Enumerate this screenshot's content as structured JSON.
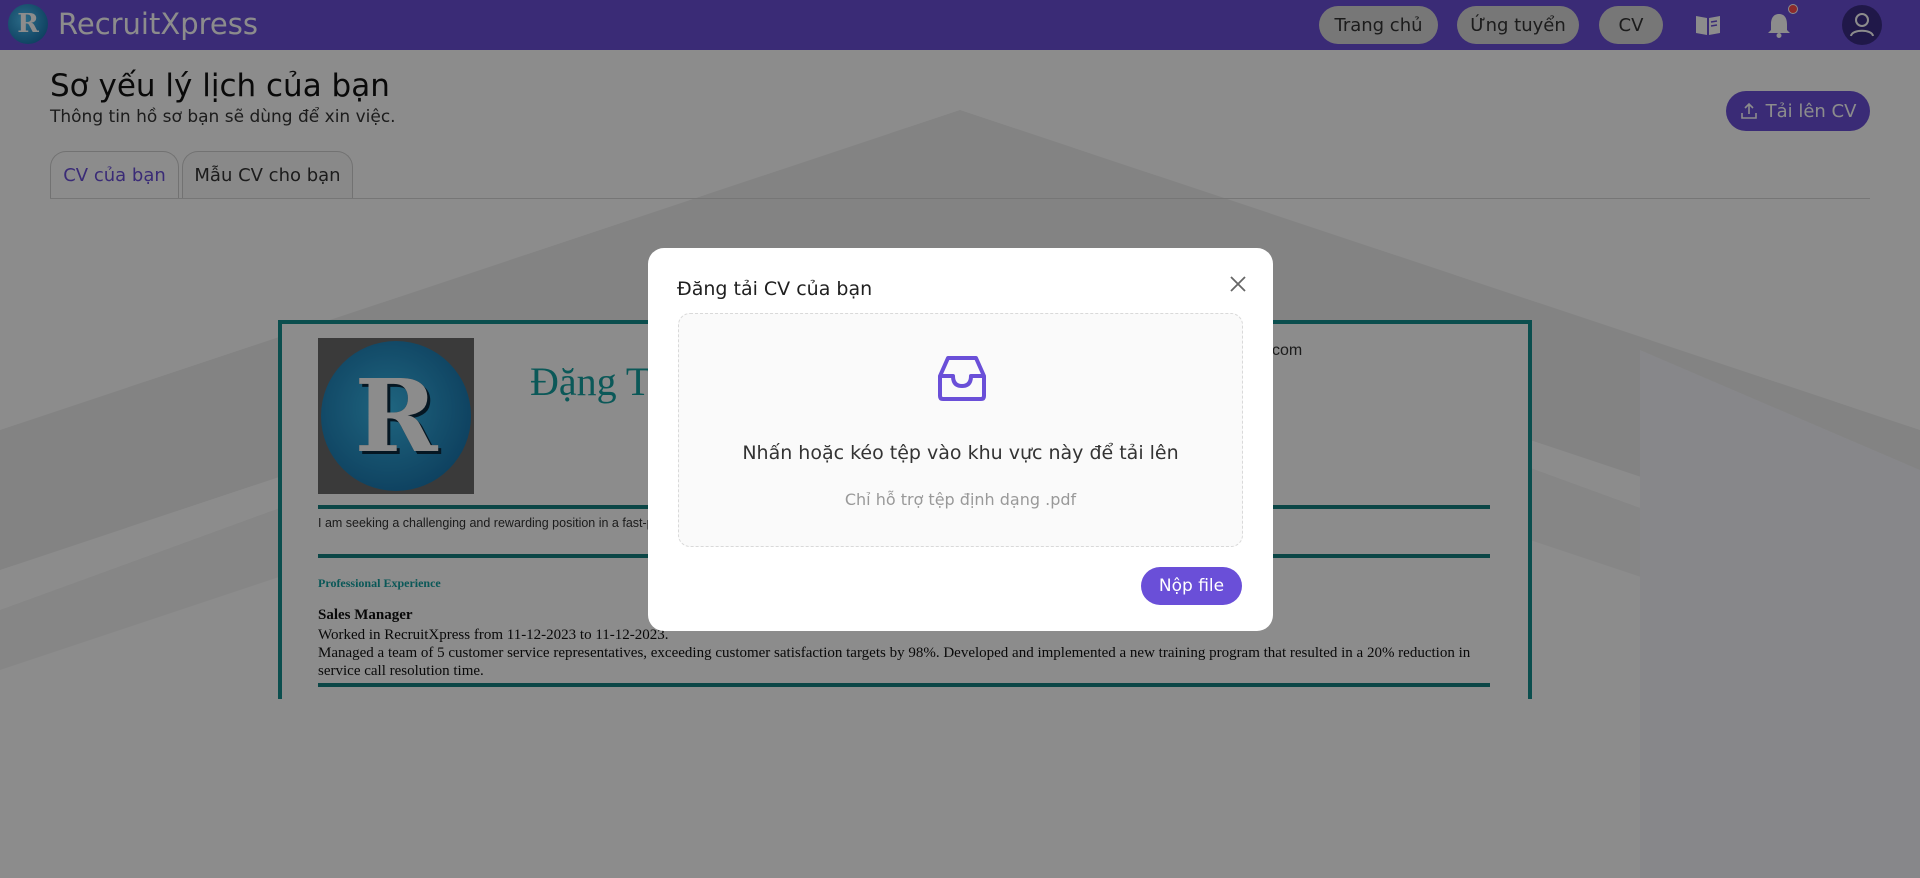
{
  "app": {
    "name": "RecruitXpress",
    "logo_letter": "R"
  },
  "nav": {
    "items": [
      {
        "label": "Trang chủ"
      },
      {
        "label": "Ứng tuyển"
      },
      {
        "label": "CV"
      }
    ],
    "icons": [
      "book-icon",
      "bell-icon",
      "user-icon"
    ]
  },
  "page": {
    "title": "Sơ yếu lý lịch của bạn",
    "subtitle": "Thông tin hồ sơ bạn sẽ dùng để xin việc.",
    "upload_button": "Tải lên CV"
  },
  "tabs": [
    {
      "label": "CV của bạn",
      "active": true
    },
    {
      "label": "Mẫu CV cho bạn",
      "active": false
    }
  ],
  "cv": {
    "name_partial": "Đặng T",
    "contact_partial": "com",
    "objective": "I am seeking a challenging and rewarding position in a fast-pa                                                                                                                                                         e about the technology industry and I am eager to learn and grow in my career.",
    "section_title": "Professional Experience",
    "job": {
      "title": "Sales Manager",
      "period": "Worked in RecruitXpress from 11-12-2023 to 11-12-2023.",
      "description": "Managed a team of 5 customer service representatives, exceeding customer satisfaction targets by 98%. Developed and implemented a new training program that resulted in a 20% reduction in service call resolution time."
    }
  },
  "modal": {
    "title": "Đăng tải CV của bạn",
    "dropzone_text": "Nhấn hoặc kéo tệp vào khu vực này để tải lên",
    "dropzone_hint": "Chỉ hỗ trợ tệp định dạng .pdf",
    "submit_label": "Nộp file"
  },
  "colors": {
    "primary": "#6a4fd8",
    "accent_teal": "#148f8f",
    "notification_dot": "#ff4d4f"
  }
}
